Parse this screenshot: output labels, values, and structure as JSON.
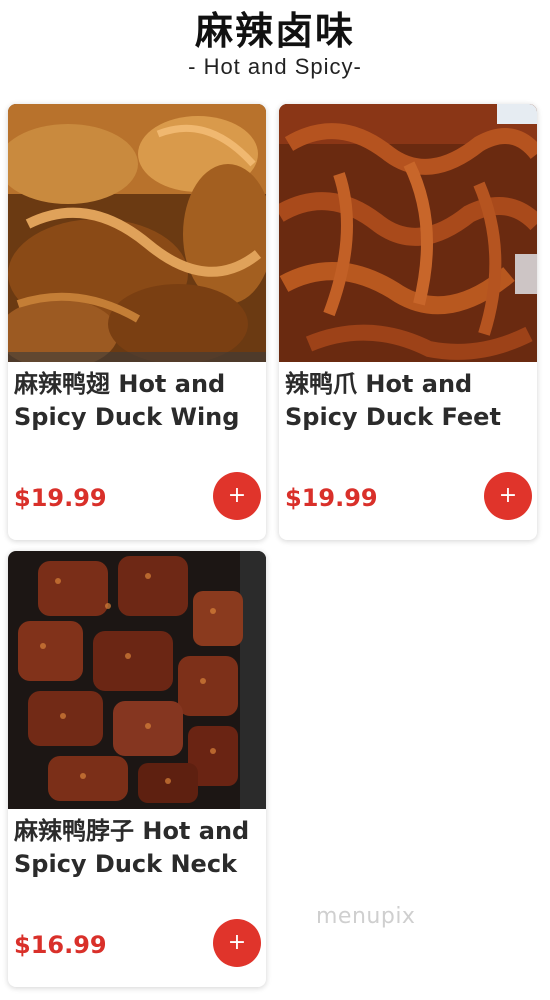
{
  "header": {
    "title": "麻辣卤味",
    "subtitle": "- Hot and Spicy-"
  },
  "items": [
    {
      "name": "麻辣鸭翅 Hot and Spicy Duck Wing",
      "price": "$19.99",
      "add_label": "+",
      "image_icon": "duck-wing-photo"
    },
    {
      "name": "辣鸭爪 Hot and Spicy Duck Feet",
      "price": "$19.99",
      "add_label": "+",
      "image_icon": "duck-feet-photo"
    },
    {
      "name": "麻辣鸭脖子 Hot and Spicy Duck Neck",
      "price": "$16.99",
      "add_label": "+",
      "image_icon": "duck-neck-photo"
    }
  ],
  "watermark": "menupix",
  "colors": {
    "price": "#d9302a",
    "button": "#e0342b"
  }
}
